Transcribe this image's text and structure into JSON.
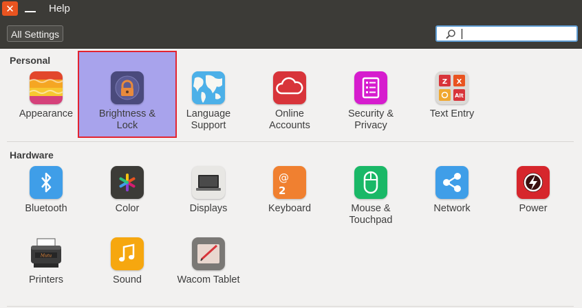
{
  "titlebar": {
    "menu": "Help"
  },
  "toolbar": {
    "all_settings": "All Settings",
    "search_value": ""
  },
  "sections": {
    "personal": {
      "title": "Personal",
      "items": [
        {
          "label": "Appearance",
          "icon": "appearance-icon"
        },
        {
          "label": "Brightness &\nLock",
          "icon": "brightness-lock-icon"
        },
        {
          "label": "Language\nSupport",
          "icon": "language-support-icon"
        },
        {
          "label": "Online\nAccounts",
          "icon": "online-accounts-icon"
        },
        {
          "label": "Security &\nPrivacy",
          "icon": "security-privacy-icon"
        },
        {
          "label": "Text Entry",
          "icon": "text-entry-icon"
        }
      ]
    },
    "hardware": {
      "title": "Hardware",
      "items": [
        {
          "label": "Bluetooth",
          "icon": "bluetooth-icon"
        },
        {
          "label": "Color",
          "icon": "color-icon"
        },
        {
          "label": "Displays",
          "icon": "displays-icon"
        },
        {
          "label": "Keyboard",
          "icon": "keyboard-icon"
        },
        {
          "label": "Mouse &\nTouchpad",
          "icon": "mouse-touchpad-icon"
        },
        {
          "label": "Network",
          "icon": "network-icon"
        },
        {
          "label": "Power",
          "icon": "power-icon"
        },
        {
          "label": "Printers",
          "icon": "printers-icon"
        },
        {
          "label": "Sound",
          "icon": "sound-icon"
        },
        {
          "label": "Wacom Tablet",
          "icon": "wacom-tablet-icon"
        }
      ]
    }
  },
  "icon_glyphs": {
    "keyboard": "@",
    "keyboard_num": "2",
    "text_z": "Z",
    "text_x": "X",
    "text_alt": "Alt",
    "printer_logo": "Mutu"
  },
  "colors": {
    "accent": "#e95420",
    "selection": "#a8a3ec",
    "selection_border": "#e3232f",
    "bluetooth": "#3f9ee8",
    "online_accounts": "#d8343a",
    "security": "#d61cce",
    "mouse": "#1ab867",
    "power": "#d6262c",
    "sound": "#f6a70f"
  }
}
